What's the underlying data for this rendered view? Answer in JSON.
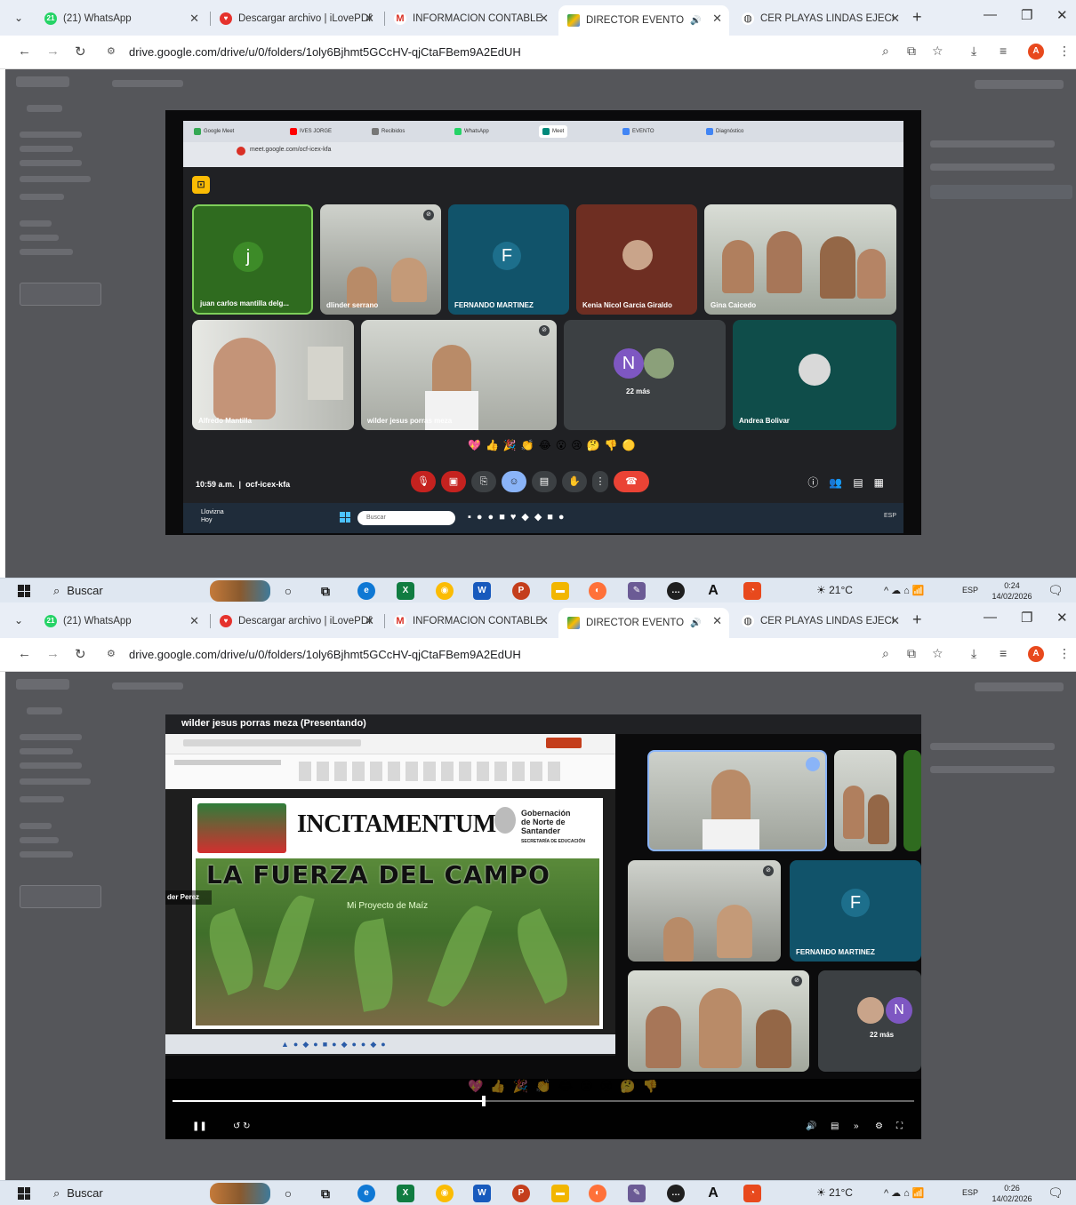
{
  "browser": {
    "tabs": [
      {
        "title": "(21) WhatsApp",
        "badge": "21"
      },
      {
        "title": "Descargar archivo | iLovePDF"
      },
      {
        "title": "INFORMACIÓN CONTABLE"
      },
      {
        "title": "DIRECTOR EVENTOS - G"
      },
      {
        "title": "CER PLAYAS LINDAS EJECUC"
      }
    ],
    "url": "drive.google.com/drive/u/0/folders/1oly6Bjhmt5GCcHV-qjCtaFBem9A2EdUH",
    "profile_initial": "A"
  },
  "meet": {
    "inner_url": "meet.google.com/ocf-icex-kfa",
    "time": "10:59 a.m.",
    "meeting_code": "ocf-icex-kfa",
    "participants": [
      {
        "name": "juan carlos mantilla delg...",
        "initial": "j"
      },
      {
        "name": "dlinder serrano"
      },
      {
        "name": "FERNANDO MARTINEZ",
        "initial": "F"
      },
      {
        "name": "Kenia Nicol Garcia Giraldo"
      },
      {
        "name": "Gina Caicedo"
      },
      {
        "name": "Alfredo Mantilla"
      },
      {
        "name": "wilder jesus porras meza"
      },
      {
        "name": "22 más",
        "initial": "N"
      },
      {
        "name": "Andrea Bolivar"
      }
    ],
    "inner_taskbar_search": "Buscar",
    "inner_taskbar_weather": "Llovizna",
    "inner_taskbar_weather_sub": "Hoy"
  },
  "presentation": {
    "presenter": "wilder jesus porras meza (Presentando)",
    "brand": "INCITAMENTUM",
    "gob_line1": "Gobernación",
    "gob_line2": "de Norte de",
    "gob_line3": "Santander",
    "gob_line4": "SECRETARÍA DE EDUCACIÓN",
    "slide_title": "LA FUERZA DEL CAMPO",
    "slide_subtitle": "Mi Proyecto de Maíz",
    "left_label": "der Perez",
    "side_names": [
      "FERNANDO MARTINEZ",
      "22 más"
    ],
    "side_initial": "N",
    "side_initial_f": "F",
    "progress": 0.42
  },
  "taskbar": {
    "search_label": "Buscar",
    "weather": "21°C",
    "language": "ESP",
    "date": "14/02/2026",
    "clock_1": "0:24",
    "clock_2": "0:26"
  },
  "colors": {
    "tab_strip": "#e9eef6",
    "meet_bg": "#202124",
    "meet_red": "#ea4335",
    "taskbar": "#dfe7f1"
  }
}
